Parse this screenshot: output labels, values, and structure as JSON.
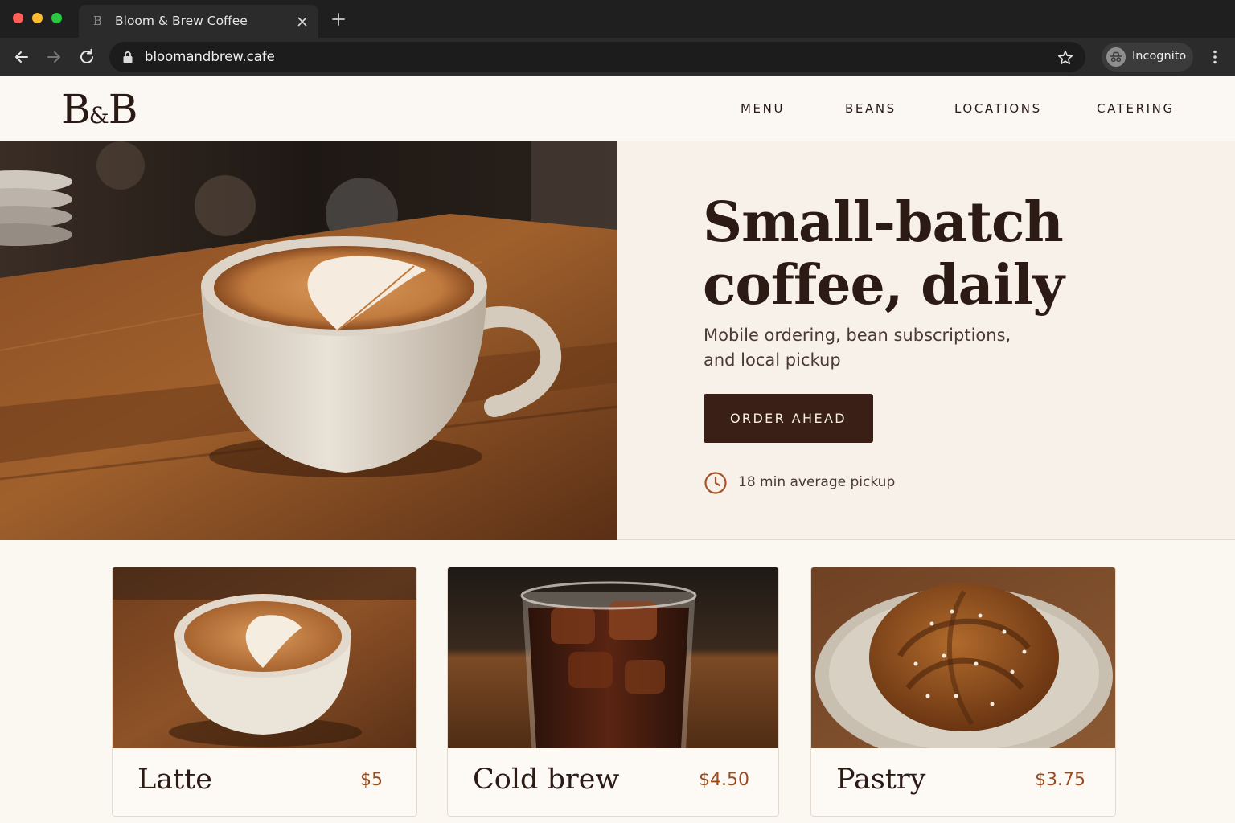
{
  "browser": {
    "tab_favicon": "B",
    "tab_title": "Bloom & Brew Coffee",
    "url": "bloomandbrew.cafe",
    "profile_label": "Incognito"
  },
  "site": {
    "logo_b1": "B",
    "logo_amp": "&",
    "logo_b2": "B",
    "nav": [
      "MENU",
      "BEANS",
      "LOCATIONS",
      "CATERING"
    ]
  },
  "hero": {
    "headline_line1": "Small-batch",
    "headline_line2": "coffee, daily",
    "subhead": "Mobile ordering, bean subscriptions, and local pickup",
    "cta_label": "ORDER AHEAD",
    "pickup_note": "18 min average pickup"
  },
  "products": [
    {
      "name": "Latte",
      "price": "$5"
    },
    {
      "name": "Cold brew",
      "price": "$4.50"
    },
    {
      "name": "Pastry",
      "price": "$3.75"
    }
  ],
  "colors": {
    "brand_dark": "#3a1f17",
    "price_accent": "#9a4c1e",
    "clock_accent": "#a8542a",
    "page_bg": "#fbf7f1"
  }
}
